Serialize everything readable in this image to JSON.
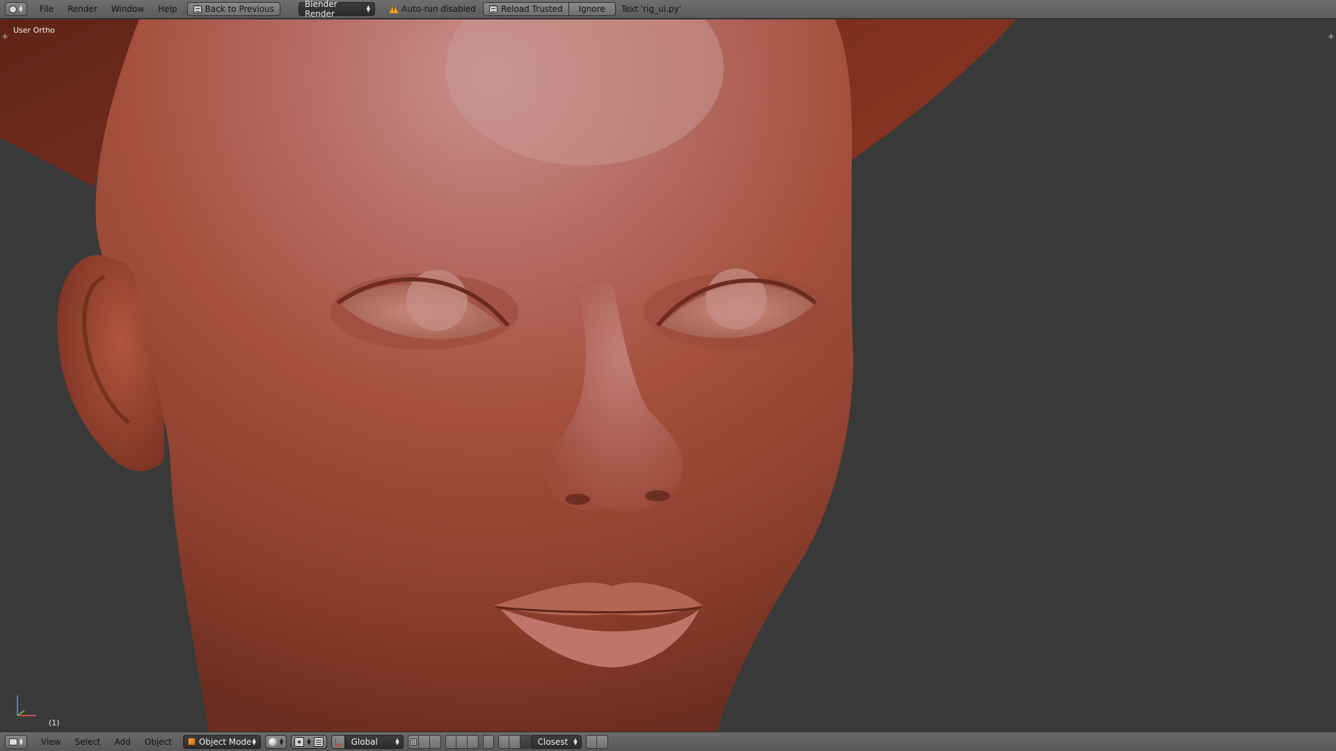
{
  "topbar": {
    "menus": [
      "File",
      "Render",
      "Window",
      "Help"
    ],
    "back_button": "Back to Previous",
    "render_engine": "Blender Render",
    "autorun_warning": "Auto-run disabled",
    "reload_trusted": "Reload Trusted",
    "ignore": "Ignore",
    "text_info": "Text 'rig_ui.py'"
  },
  "viewport": {
    "view_name": "User Ortho",
    "frame": "(1)"
  },
  "bottombar": {
    "menus": [
      "View",
      "Select",
      "Add",
      "Object"
    ],
    "mode": "Object Mode",
    "orientation": "Global",
    "snap_element": "Closest"
  },
  "colors": {
    "skin": "#a5462f",
    "skin_highlight": "#c9908c",
    "background": "#393939",
    "header": "#5e5e5e"
  },
  "icons": {
    "editor_type": "info-icon",
    "warning": "warning-icon",
    "view_editor_type": "3d-view-icon",
    "object_mode": "cube-icon",
    "viewport_shading": "sphere-icon"
  }
}
